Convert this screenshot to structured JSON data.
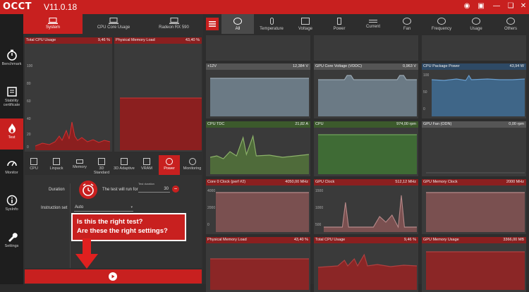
{
  "app": {
    "logo": "OCCT",
    "version": "V11.0.18"
  },
  "window_controls": [
    "camera-icon",
    "screenshot-icon",
    "minimize-icon",
    "close-icon"
  ],
  "left_nav": [
    {
      "label": "Benchmark"
    },
    {
      "label": "Stability certificate"
    },
    {
      "label": "Test"
    },
    {
      "label": "Monitor"
    },
    {
      "label": "SysInfo"
    },
    {
      "label": "Settings"
    }
  ],
  "top_tabs": [
    {
      "label": "System"
    },
    {
      "label": "CPU Core Usage"
    },
    {
      "label": "Radeon RX 590"
    }
  ],
  "left_charts": {
    "cpu_usage": {
      "title": "Total CPU Usage",
      "value": "9,46 %",
      "ticks": [
        "100",
        "80",
        "60",
        "40",
        "20",
        "0"
      ]
    },
    "mem_load": {
      "title": "Physical Memory Load",
      "value": "43,40 %"
    }
  },
  "test_tabs": [
    {
      "label": "CPU"
    },
    {
      "label": "Linpack"
    },
    {
      "label": "Memory"
    },
    {
      "label": "3D Standard"
    },
    {
      "label": "3D Adaptive"
    },
    {
      "label": "VRAM"
    },
    {
      "label": "Power"
    },
    {
      "label": "Monitoring"
    }
  ],
  "settings": {
    "duration_label": "Duration",
    "duration_text": "The test will run for",
    "duration_hint": "Test duration",
    "duration_value": "30",
    "instruction_label": "Instruction set",
    "instruction_value": "Auto"
  },
  "annotation": {
    "line1": "Is this the right test?",
    "line2": "Are these the right settings?"
  },
  "right_tabs": [
    {
      "label": "All"
    },
    {
      "label": "Temperature"
    },
    {
      "label": "Voltage"
    },
    {
      "label": "Power"
    },
    {
      "label": "Current"
    },
    {
      "label": "Fan"
    },
    {
      "label": "Frequency"
    },
    {
      "label": "Usage"
    },
    {
      "label": "Others"
    }
  ],
  "right_charts": [
    {
      "title": "+12V",
      "value": "12,384 V",
      "ticks": [],
      "head": "grey",
      "plot": "#6b7a85",
      "line": "#9aa9b4"
    },
    {
      "title": "GPU Core Voltage (VDDC)",
      "value": "0,963 V",
      "ticks": [],
      "head": "grey",
      "plot": "#6b7a85",
      "line": "#9aa9b4"
    },
    {
      "title": "CPU Package Power",
      "value": "43,94 W",
      "ticks": [
        "100",
        "50",
        "0"
      ],
      "head": "blue",
      "plot": "#3f6688",
      "line": "#6a9fd0"
    },
    {
      "title": "CPU TDC",
      "value": "21,82 A",
      "ticks": [],
      "head": "green",
      "plot": "#4f6b3a",
      "line": "#8db36a"
    },
    {
      "title": "CPU",
      "value": "974,00 rpm",
      "ticks": [],
      "head": "green",
      "plot": "#3f6b35",
      "line": "#6fa55a"
    },
    {
      "title": "GPU Fan (ODN)",
      "value": "0,00 rpm",
      "ticks": [],
      "head": "grey",
      "plot": "#3a3a3a",
      "line": "#555"
    },
    {
      "title": "Core 0 Clock (perf #2)",
      "value": "4050,00 MHz",
      "ticks": [
        "4000",
        "2000",
        "0"
      ],
      "head": "red",
      "plot": "#7a5050",
      "line": "#b88a8a"
    },
    {
      "title": "GPU Clock",
      "value": "512,12 MHz",
      "ticks": [
        "1500",
        "1000",
        "500"
      ],
      "head": "red",
      "plot": "#7a5050",
      "line": "#b88a8a"
    },
    {
      "title": "GPU Memory Clock",
      "value": "2000 MHz",
      "ticks": [],
      "head": "red",
      "plot": "#7a5050",
      "line": "#b88a8a"
    },
    {
      "title": "Physical Memory Load",
      "value": "43,40 %",
      "ticks": [],
      "head": "red",
      "plot": "#8b2626",
      "line": "#b04040"
    },
    {
      "title": "Total CPU Usage",
      "value": "9,46 %",
      "ticks": [],
      "head": "red",
      "plot": "#8b2626",
      "line": "#b04040"
    },
    {
      "title": "GPU Memory Usage",
      "value": "3366,00 MB",
      "ticks": [],
      "head": "red",
      "plot": "#8b2626",
      "line": "#b04040"
    }
  ]
}
